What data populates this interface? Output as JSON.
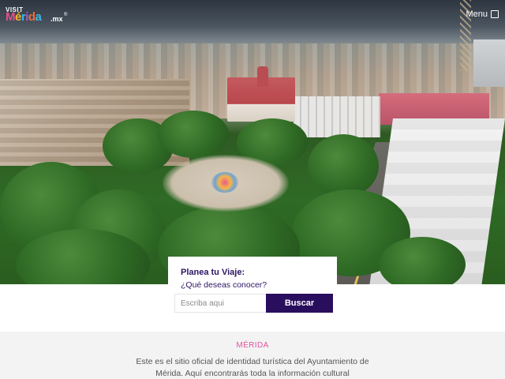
{
  "header": {
    "logo": {
      "visit": "VISIT",
      "merida_letters": [
        "M",
        "é",
        "r",
        "i",
        "d",
        "a"
      ],
      "mx": ".mx",
      "reg": "®",
      "colors": [
        "#e84d8a",
        "#f3b628",
        "#3fb6e6",
        "#9b5fd0",
        "#ef6b3a"
      ]
    },
    "menu_label": "Menu"
  },
  "hero": {
    "image_subject": "aerial view of main plaza and cathedral"
  },
  "search": {
    "title": "Planea tu Viaje:",
    "subtitle": "¿Qué deseas conocer?",
    "placeholder": "Escriba aqui",
    "button_label": "Buscar"
  },
  "info": {
    "heading": "MÉRIDA",
    "text": "Este es el sitio oficial de identidad turística del Ayuntamiento de Mérida. Aquí encontrarás toda la información cultural"
  },
  "colors": {
    "brand_purple": "#2a0e5e",
    "accent_pink": "#e055a0"
  }
}
